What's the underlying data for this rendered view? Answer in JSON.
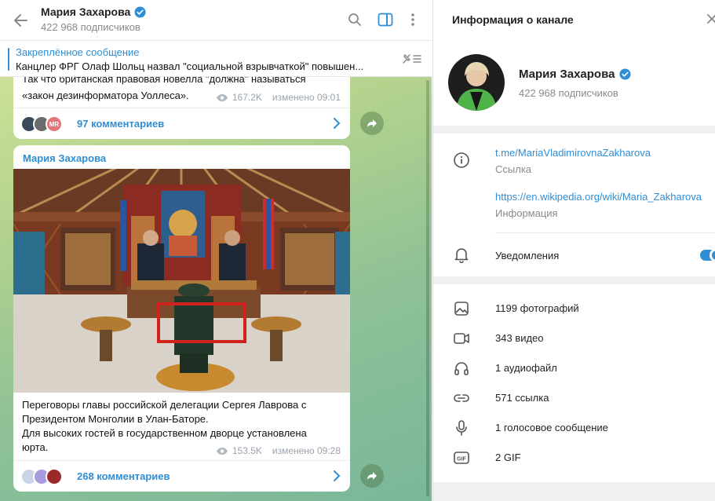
{
  "chat": {
    "title": "Мария Захарова",
    "subscribers": "422 968 подписчиков",
    "pinned": {
      "title": "Закреплённое сообщение",
      "text": "Канцлер ФРГ Олаф Шольц назвал \"социальной взрывчаткой\" повышен..."
    },
    "messages": [
      {
        "text_line1": "Так что британская правовая новелла \"должна\" называться",
        "text_line2": "«закон дезинформатора Уоллеса».",
        "views": "167.2K",
        "edited": "изменено 09:01",
        "comments": "97 комментариев",
        "avatar_initials": "MR"
      },
      {
        "author": "Мария Захарова",
        "text_line1": "Переговоры главы российской делегации Сергея Лаврова с",
        "text_line2": "Президентом Монголии в Улан-Баторе.",
        "text_line3": "Для высоких гостей в государственном дворце установлена",
        "text_line4": "юрта.",
        "views": "153.5K",
        "edited": "изменено 09:28",
        "comments": "268 комментариев"
      }
    ]
  },
  "info": {
    "title": "Информация о канале",
    "name": "Мария Захарова",
    "subscribers": "422 968 подписчиков",
    "link1": "t.me/MariaVladimirovnaZakharova",
    "link1_label": "Ссылка",
    "link2": "https://en.wikipedia.org/wiki/Maria_Zakharova",
    "link2_label": "Информация",
    "notifications": "Уведомления",
    "media": [
      {
        "icon": "photo-icon",
        "label": "1199 фотографий"
      },
      {
        "icon": "video-icon",
        "label": "343 видео"
      },
      {
        "icon": "headphones-icon",
        "label": "1 аудиофайл"
      },
      {
        "icon": "link-icon",
        "label": "571 ссылка"
      },
      {
        "icon": "microphone-icon",
        "label": "1 голосовое сообщение"
      },
      {
        "icon": "gif-icon",
        "label": "2 GIF"
      }
    ]
  },
  "colors": {
    "accent": "#2f8ed4",
    "secondary_text": "#8a8a8a"
  }
}
